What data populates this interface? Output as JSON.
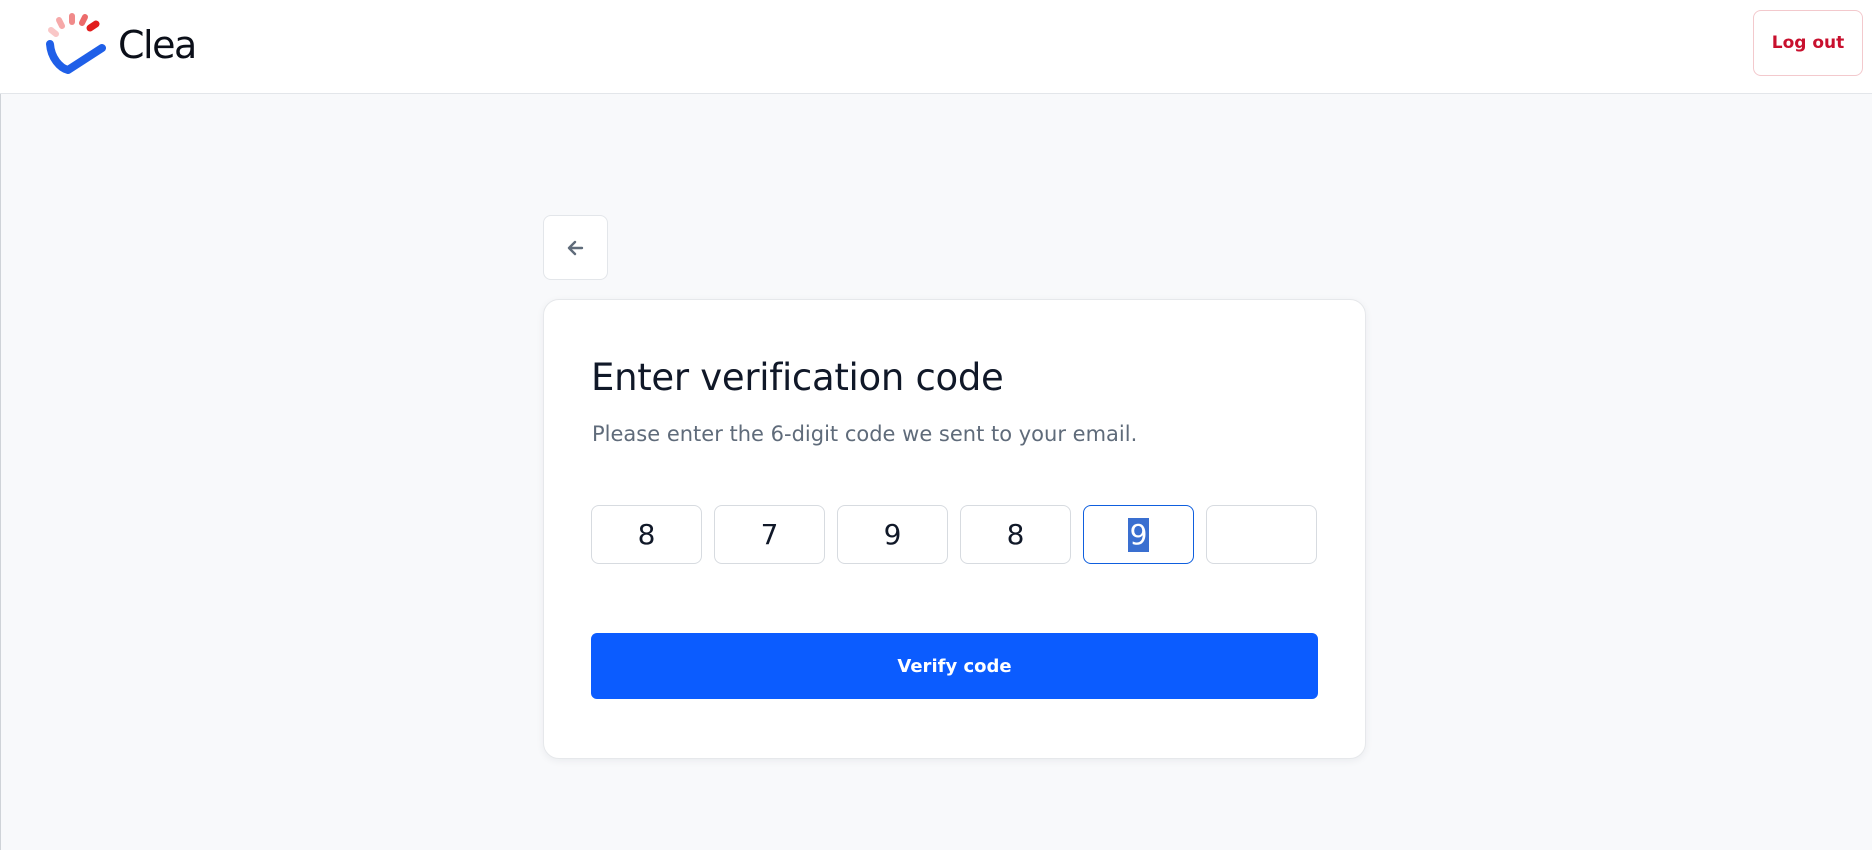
{
  "header": {
    "brand_name": "Clea",
    "logo_icon": "clea-logo-icon",
    "logout_label": "Log out",
    "logout_color": "#c8102e"
  },
  "nav": {
    "back_icon": "arrow-left-icon"
  },
  "verification": {
    "title": "Enter verification code",
    "subtitle": "Please enter the 6-digit code we sent to your email.",
    "digits": [
      "8",
      "7",
      "9",
      "8",
      "9",
      ""
    ],
    "focused_index": 4,
    "verify_label": "Verify code",
    "accent_color": "#0b5cff"
  }
}
